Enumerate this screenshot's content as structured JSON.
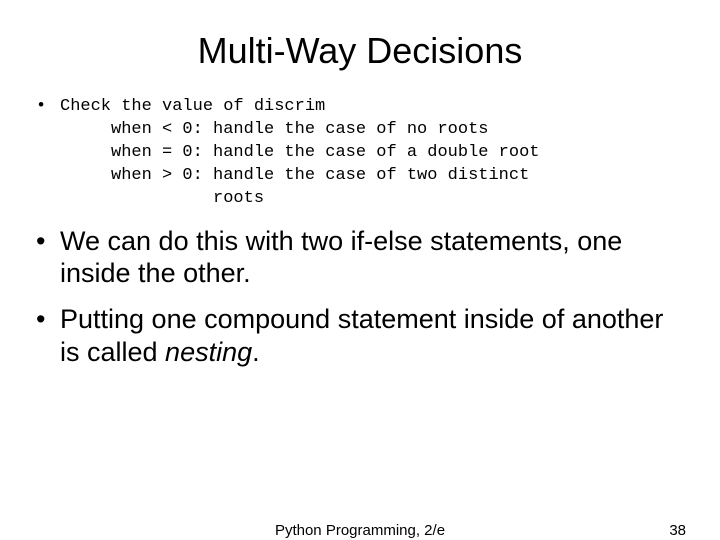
{
  "title": "Multi-Way Decisions",
  "code": {
    "l1": "Check the value of discrim",
    "l2": "     when < 0: handle the case of no roots",
    "l3": "     when = 0: handle the case of a double root",
    "l4": "     when > 0: handle the case of two distinct",
    "l5": "               roots"
  },
  "bullet2": "We can do this with two if-else statements, one inside the other.",
  "bullet3_a": "Putting one compound statement inside of another is called ",
  "bullet3_em": "nesting",
  "bullet3_b": ".",
  "footer": {
    "center": "Python Programming, 2/e",
    "page": "38"
  }
}
